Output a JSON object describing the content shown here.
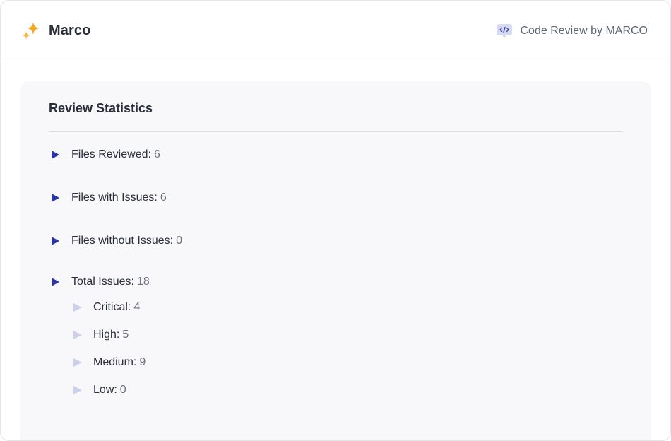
{
  "header": {
    "brand_name": "Marco",
    "brand_icon": "sparkles-icon",
    "product_name": "Code Review by MARCO",
    "product_icon": "code-chat-icon"
  },
  "panel": {
    "title": "Review Statistics",
    "stats": [
      {
        "label": "Files Reviewed:",
        "value": "6"
      },
      {
        "label": "Files with Issues:",
        "value": "6"
      },
      {
        "label": "Files without Issues:",
        "value": "0"
      },
      {
        "label": "Total Issues:",
        "value": "18"
      }
    ],
    "severity": [
      {
        "label": "Critical:",
        "value": "4"
      },
      {
        "label": "High:",
        "value": "5"
      },
      {
        "label": "Medium:",
        "value": "9"
      },
      {
        "label": "Low:",
        "value": "0"
      }
    ]
  },
  "colors": {
    "accent": "#2b35a6",
    "sub_marker": "#cdd0ec",
    "brand_icon": "#f5a623",
    "panel_bg": "#f8f8fb"
  }
}
